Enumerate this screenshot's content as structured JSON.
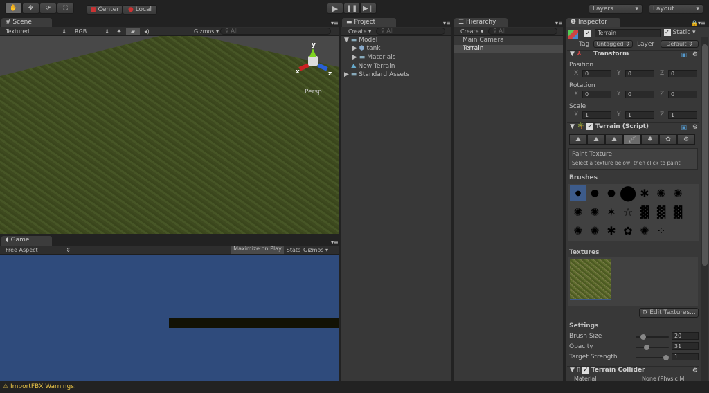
{
  "toolbar": {
    "center": "Center",
    "local": "Local",
    "layers": "Layers",
    "layout": "Layout"
  },
  "scene": {
    "tab": "Scene",
    "render_mode": "Textured",
    "color_mode": "RGB",
    "gizmos": "Gizmos",
    "search": "All",
    "persp": "Persp",
    "axes": {
      "x": "x",
      "y": "y",
      "z": "z"
    }
  },
  "game": {
    "tab": "Game",
    "aspect": "Free Aspect",
    "maximize": "Maximize on Play",
    "stats": "Stats",
    "gizmos": "Gizmos"
  },
  "project": {
    "tab": "Project",
    "create": "Create",
    "search": "All",
    "items": [
      {
        "label": "Model"
      },
      {
        "label": "tank"
      },
      {
        "label": "Materials"
      },
      {
        "label": "New Terrain"
      },
      {
        "label": "Standard Assets"
      }
    ]
  },
  "hierarchy": {
    "tab": "Hierarchy",
    "create": "Create",
    "search": "All",
    "items": [
      {
        "label": "Main Camera"
      },
      {
        "label": "Terrain"
      }
    ]
  },
  "inspector": {
    "tab": "Inspector",
    "name": "Terrain",
    "static": "Static",
    "tag_label": "Tag",
    "tag": "Untagged",
    "layer_label": "Layer",
    "layer": "Default",
    "transform": {
      "title": "Transform",
      "position": "Position",
      "rotation": "Rotation",
      "scale": "Scale",
      "x": "X",
      "y": "Y",
      "z": "Z",
      "pos": [
        "0",
        "0",
        "0"
      ],
      "rot": [
        "0",
        "0",
        "0"
      ],
      "scl": [
        "1",
        "1",
        "1"
      ]
    },
    "terrain": {
      "title": "Terrain (Script)",
      "tool_title": "Paint Texture",
      "tool_desc": "Select a texture below, then click to paint",
      "brushes": "Brushes",
      "textures": "Textures",
      "edit_textures": "Edit Textures...",
      "settings": "Settings",
      "brush_size_label": "Brush Size",
      "brush_size": "20",
      "opacity_label": "Opacity",
      "opacity": "31",
      "target_label": "Target Strength",
      "target": "1"
    },
    "collider": {
      "title": "Terrain Collider",
      "material_label": "Material",
      "material": "None (Physic M"
    }
  },
  "status": {
    "warning": "ImportFBX Warnings:"
  },
  "colors": {
    "game_bg": "#2f4b7c",
    "selection": "#3d5b8a",
    "warning": "#e8c347"
  }
}
